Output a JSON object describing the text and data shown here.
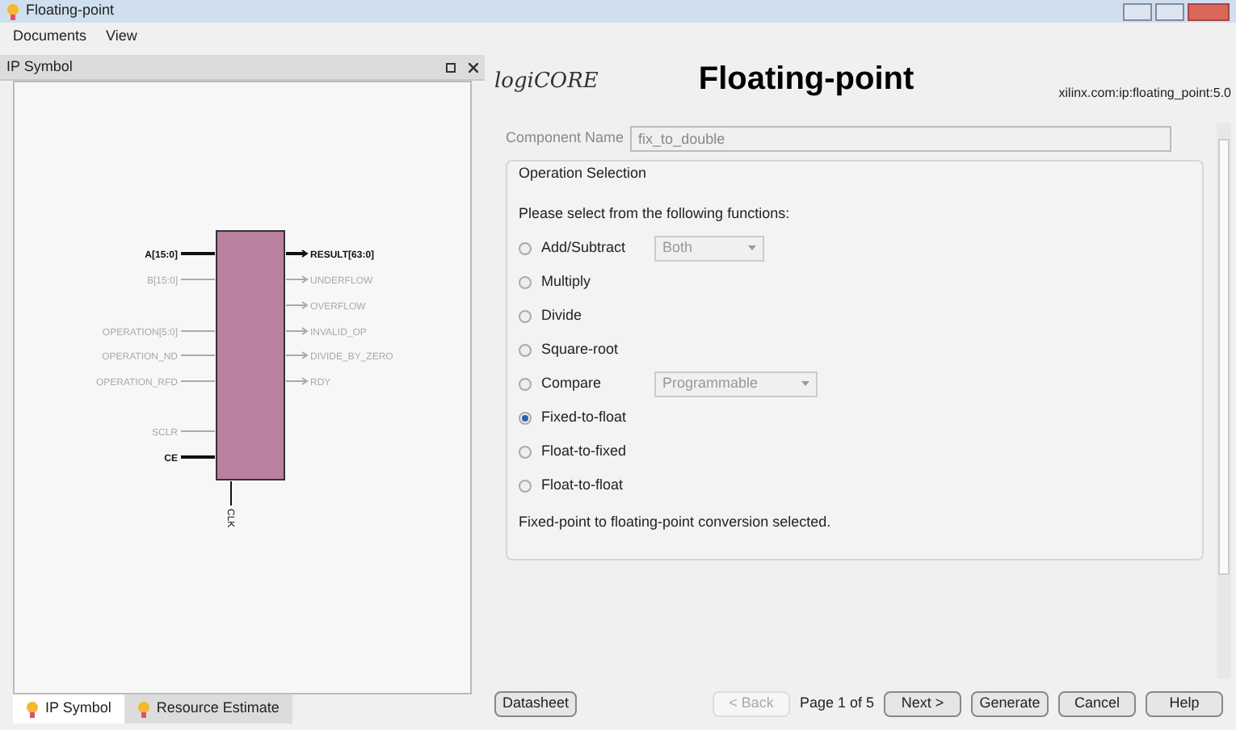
{
  "window": {
    "title": "Floating-point"
  },
  "menu": [
    {
      "label": "Documents"
    },
    {
      "label": "View"
    }
  ],
  "symbol_panel": {
    "title": "IP Symbol",
    "input_pins": [
      {
        "name": "A[15:0]",
        "active": true
      },
      {
        "name": "B[15:0]",
        "active": false
      },
      {
        "name": "OPERATION[5:0]",
        "active": false
      },
      {
        "name": "OPERATION_ND",
        "active": false
      },
      {
        "name": "OPERATION_RFD",
        "active": false
      },
      {
        "name": "SCLR",
        "active": false
      },
      {
        "name": "CE",
        "active": true
      }
    ],
    "output_pins": [
      {
        "name": "RESULT[63:0]",
        "active": true
      },
      {
        "name": "UNDERFLOW",
        "active": false
      },
      {
        "name": "OVERFLOW",
        "active": false
      },
      {
        "name": "INVALID_OP",
        "active": false
      },
      {
        "name": "DIVIDE_BY_ZERO",
        "active": false
      },
      {
        "name": "RDY",
        "active": false
      }
    ],
    "clock_pins": [
      {
        "name": "CLK",
        "active": true
      }
    ]
  },
  "bottom_tabs": [
    {
      "label": "IP Symbol",
      "selected": true
    },
    {
      "label": "Resource Estimate",
      "selected": false
    }
  ],
  "header": {
    "logo": "logiCORE",
    "title": "Floating-point",
    "vendor": "xilinx.com:ip:floating_point:5.0"
  },
  "component_name": {
    "label": "Component Name",
    "value": "fix_to_double"
  },
  "operation_selection": {
    "title": "Operation Selection",
    "prompt": "Please select from the following functions:",
    "options": [
      {
        "label": "Add/Subtract",
        "selected": false,
        "dropdown": "Both"
      },
      {
        "label": "Multiply",
        "selected": false
      },
      {
        "label": "Divide",
        "selected": false
      },
      {
        "label": "Square-root",
        "selected": false
      },
      {
        "label": "Compare",
        "selected": false,
        "dropdown": "Programmable"
      },
      {
        "label": "Fixed-to-float",
        "selected": true
      },
      {
        "label": "Float-to-fixed",
        "selected": false
      },
      {
        "label": "Float-to-float",
        "selected": false
      }
    ],
    "status": "Fixed-point to floating-point conversion selected."
  },
  "footer": {
    "datasheet": "Datasheet",
    "page": "Page 1 of 5",
    "buttons": [
      {
        "label": "< Back",
        "disabled": true
      },
      {
        "label": "Next >",
        "disabled": false
      },
      {
        "label": "Generate",
        "disabled": false
      },
      {
        "label": "Cancel",
        "disabled": false
      },
      {
        "label": "Help",
        "disabled": false
      }
    ]
  }
}
